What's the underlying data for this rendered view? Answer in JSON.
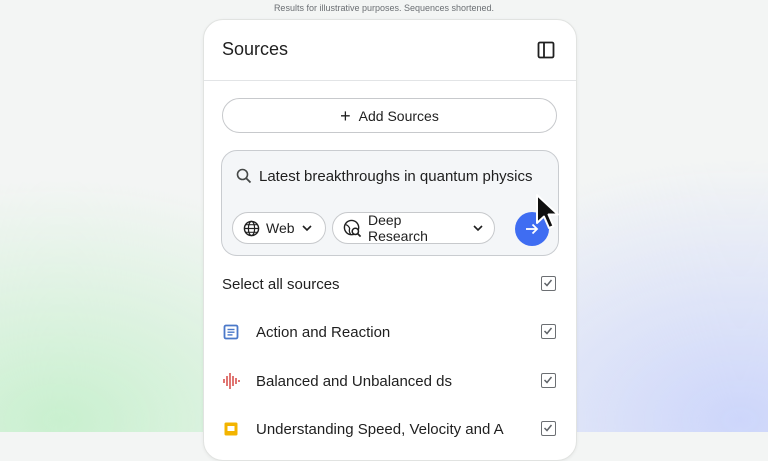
{
  "disclaimer": "Results for illustrative purposes. Sequences shortened.",
  "panel": {
    "title": "Sources",
    "toggle_icon": "sidebar-panel-icon"
  },
  "add_sources": {
    "label": "Add Sources",
    "icon": "plus-icon"
  },
  "search": {
    "value": "Latest breakthroughs in quantum physics",
    "icon": "search-icon",
    "source_chip": {
      "label": "Web",
      "icon": "globe-icon"
    },
    "mode_chip": {
      "label": "Deep Research",
      "icon": "deep-research-globe-icon"
    },
    "submit_icon": "arrow-right-icon"
  },
  "select_all": {
    "label": "Select all sources",
    "checked": true
  },
  "sources": [
    {
      "label": "Action and Reaction",
      "icon": "document-icon",
      "color": "#4a78c9",
      "checked": true
    },
    {
      "label": "Balanced and Unbalanced ds",
      "icon": "audio-waveform-icon",
      "color": "#d9534f",
      "checked": true
    },
    {
      "label": "Understanding Speed, Velocity and A",
      "icon": "slides-icon",
      "color": "#f3b400",
      "checked": true
    }
  ],
  "colors": {
    "accent": "#3f6df2",
    "panel_bg": "#ffffff",
    "search_bg": "#f4f6f8"
  }
}
